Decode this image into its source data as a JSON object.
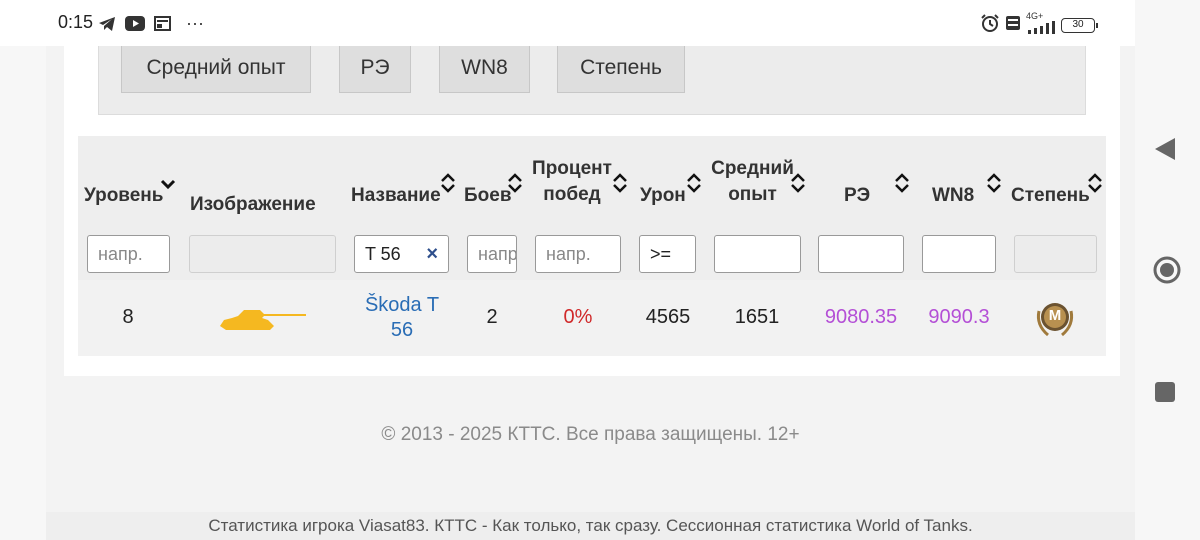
{
  "status_bar": {
    "time": "0:15",
    "more": "···",
    "network": "4G+",
    "battery": "30"
  },
  "sort_buttons": [
    "Средний опыт",
    "РЭ",
    "WN8",
    "Степень"
  ],
  "table": {
    "headers": {
      "level": "Уровень",
      "image": "Изображение",
      "name": "Название",
      "battles": "Боев",
      "winrate_1": "Процент",
      "winrate_2": "побед",
      "damage": "Урон",
      "avg_exp_1": "Средний",
      "avg_exp_2": "опыт",
      "re": "РЭ",
      "wn8": "WN8",
      "grade": "Степень"
    },
    "filters": {
      "level_placeholder": "напр.",
      "name_value": "T 56",
      "battles_placeholder": "напр.",
      "winrate_placeholder": "напр.",
      "damage_value": ">="
    },
    "row": {
      "level": "8",
      "name_1": "Škoda T",
      "name_2": "56",
      "battles": "2",
      "winrate": "0%",
      "damage": "4565",
      "avg_exp": "1651",
      "re": "9080.35",
      "wn8": "9090.3",
      "grade_badge": "M"
    }
  },
  "footer": "© 2013 - 2025 КТТС. Все права защищены. 12+",
  "bottom_text": "Статистика игрока Viasat83. КТТС - Как только, так сразу. Сессионная статистика World of Tanks.",
  "colors": {
    "link": "#2a6db5",
    "winrate": "#d0292a",
    "rating": "#b44fd6",
    "tank": "#f5b820"
  },
  "icons": [
    "telegram-icon",
    "youtube-icon",
    "news-icon",
    "alarm-icon",
    "volte-icon",
    "signal-icon",
    "battery-icon",
    "back-nav-icon",
    "home-nav-icon",
    "recents-nav-icon",
    "sort-icon",
    "clear-icon",
    "tank-icon",
    "mastery-badge-icon"
  ]
}
